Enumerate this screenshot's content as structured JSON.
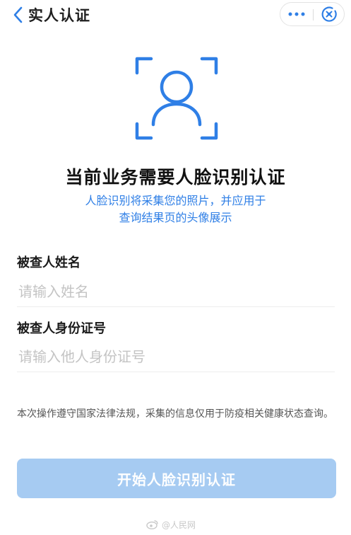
{
  "nav": {
    "title": "实人认证",
    "back_icon": "chevron-left-icon",
    "more_icon": "more-dots-icon",
    "close_icon": "close-circle-icon"
  },
  "hero": {
    "icon": "face-scan-icon",
    "headline": "当前业务需要人脸识别认证",
    "sub_line1": "人脸识别将采集您的照片，并应用于",
    "sub_line2": "查询结果页的头像展示"
  },
  "form": {
    "name_label": "被查人姓名",
    "name_placeholder": "请输入姓名",
    "name_value": "",
    "id_label": "被查人身份证号",
    "id_placeholder": "请输入他人身份证号",
    "id_value": ""
  },
  "notice": "本次操作遵守国家法律法规，采集的信息仅用于防疫相关健康状态查询。",
  "start_button": "开始人脸识别认证",
  "watermark": "@人民网",
  "colors": {
    "accent": "#2f7fe6",
    "button_disabled": "#a6cbf2"
  }
}
